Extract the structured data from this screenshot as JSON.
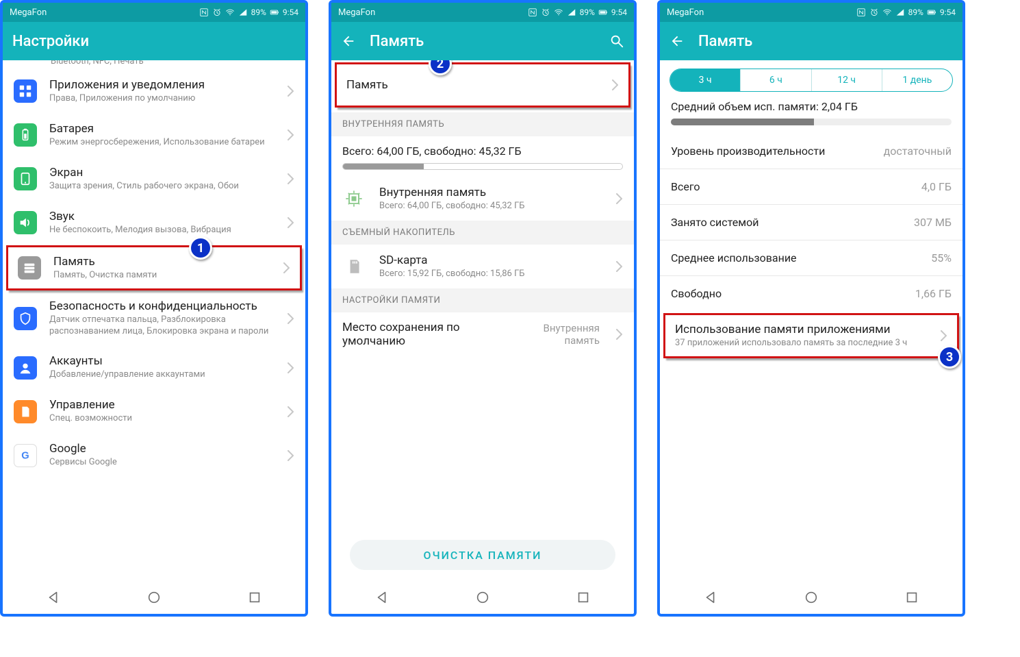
{
  "statusbar": {
    "carrier": "MegaFon",
    "battery": "89%",
    "time": "9:54"
  },
  "screen1": {
    "title": "Настройки",
    "cut_header": "Bluetooth, NFC, Печать",
    "items": [
      {
        "title": "Приложения и уведомления",
        "sub": "Права, Приложения по умолчанию",
        "iconColor": "#2a6cff",
        "icon": "apps"
      },
      {
        "title": "Батарея",
        "sub": "Режим энергосбережения, Использование батареи",
        "iconColor": "#2fbf6b",
        "icon": "battery"
      },
      {
        "title": "Экран",
        "sub": "Защита зрения, Стиль рабочего экрана, Обои",
        "iconColor": "#2fbf6b",
        "icon": "screen"
      },
      {
        "title": "Звук",
        "sub": "Не беспокоить, Мелодия вызова, Вибрация",
        "iconColor": "#2fbf6b",
        "icon": "sound"
      },
      {
        "title": "Память",
        "sub": "Память, Очистка памяти",
        "iconColor": "#9a9a9a",
        "icon": "storage",
        "highlight": true,
        "badge": "1"
      },
      {
        "title": "Безопасность и конфиденциальность",
        "sub": "Датчик отпечатка пальца, Разблокировка распознаванием лица, Блокировка экрана и пароли",
        "iconColor": "#2a6cff",
        "icon": "security"
      },
      {
        "title": "Аккаунты",
        "sub": "Добавление/управление аккаунтами",
        "iconColor": "#2a6cff",
        "icon": "account"
      },
      {
        "title": "Управление",
        "sub": "Спец. возможности",
        "iconColor": "#ff8a2a",
        "icon": "smart"
      },
      {
        "title": "Google",
        "sub": "Сервисы Google",
        "iconColor": "#2a6cff",
        "icon": "google"
      }
    ]
  },
  "screen2": {
    "title": "Память",
    "ram_row": {
      "title": "Память",
      "highlight": true,
      "badge": "2"
    },
    "sect_internal": "ВНУТРЕННЯЯ ПАМЯТЬ",
    "total_line": "Всего: 64,00 ГБ, свободно: 45,32 ГБ",
    "internal_pct": 29,
    "internal_row": {
      "title": "Внутренняя память",
      "sub": "Всего: 64,00 ГБ, свободно: 45,32 ГБ"
    },
    "sect_removable": "СЪЕМНЫЙ НАКОПИТЕЛЬ",
    "sd_row": {
      "title": "SD-карта",
      "sub": "Всего: 15,92 ГБ, свободно: 15,86 ГБ"
    },
    "sect_settings": "НАСТРОЙКИ ПАМЯТИ",
    "default_loc": {
      "title": "Место сохранения по умолчанию",
      "value": "Внутренняя память"
    },
    "clean_btn": "ОЧИСТКА ПАМЯТИ"
  },
  "screen3": {
    "title": "Память",
    "seg": [
      "3 ч",
      "6 ч",
      "12 ч",
      "1 день"
    ],
    "seg_active": 0,
    "avg_label": "Средний объем исп. памяти: 2,04 ГБ",
    "ram_pct": 51,
    "kv": [
      {
        "k": "Уровень производительности",
        "v": "достаточный"
      },
      {
        "k": "Всего",
        "v": "4,0 ГБ"
      },
      {
        "k": "Занято системой",
        "v": "307 МБ"
      },
      {
        "k": "Среднее использование",
        "v": "55%"
      },
      {
        "k": "Свободно",
        "v": "1,66 ГБ"
      }
    ],
    "appusage": {
      "title": "Использование памяти приложениями",
      "sub": "37 приложений использовало память за последние 3 ч",
      "highlight": true,
      "badge": "3"
    }
  }
}
